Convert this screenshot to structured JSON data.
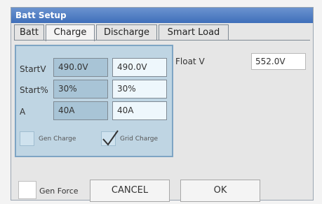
{
  "window": {
    "title": "Batt Setup"
  },
  "tabs": [
    {
      "label": "Batt"
    },
    {
      "label": "Charge"
    },
    {
      "label": "Discharge"
    },
    {
      "label": "Smart Load"
    }
  ],
  "charge": {
    "rows": [
      {
        "label": "StartV",
        "value_dim": "490.0V",
        "value": "490.0V"
      },
      {
        "label": "Start%",
        "value_dim": "30%",
        "value": "30%"
      },
      {
        "label": "A",
        "value_dim": "40A",
        "value": "40A"
      }
    ],
    "gen_charge": {
      "label": "Gen Charge",
      "checked": false
    },
    "grid_charge": {
      "label": "Grid Charge",
      "checked": true
    }
  },
  "float": {
    "label": "Float V",
    "value": "552.0V"
  },
  "footer": {
    "gen_force": {
      "label": "Gen Force",
      "checked": false
    },
    "cancel_label": "CANCEL",
    "ok_label": "OK"
  }
}
